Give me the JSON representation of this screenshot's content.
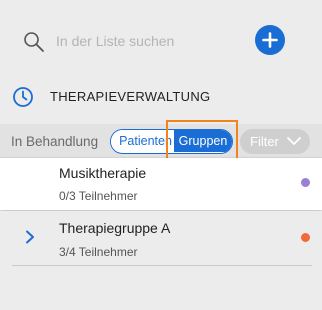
{
  "search": {
    "placeholder": "In der Liste suchen",
    "icon": "search-icon"
  },
  "add_button": {
    "icon": "plus-icon",
    "color": "#1a6dd4"
  },
  "section": {
    "title": "THERAPIEVERWALTUNG",
    "icon": "clock-icon"
  },
  "filter_bar": {
    "status_label": "In Behandlung",
    "toggle": {
      "options": [
        "Patienten",
        "Gruppen"
      ],
      "selected": "Gruppen"
    },
    "filter_label": "Filter",
    "filter_icon": "chevron-down-icon"
  },
  "groups": [
    {
      "name": "Musiktherapie",
      "participants": "0/3 Teilnehmer",
      "color": "#9b7fd4",
      "selected": true
    },
    {
      "name": "Therapiegruppe A",
      "participants": "3/4 Teilnehmer",
      "color": "#f06a3c",
      "expand_icon": "chevron-right-icon"
    }
  ],
  "colors": {
    "accent": "#1a6dd4",
    "highlight": "#f0841e",
    "background": "#ececec"
  }
}
